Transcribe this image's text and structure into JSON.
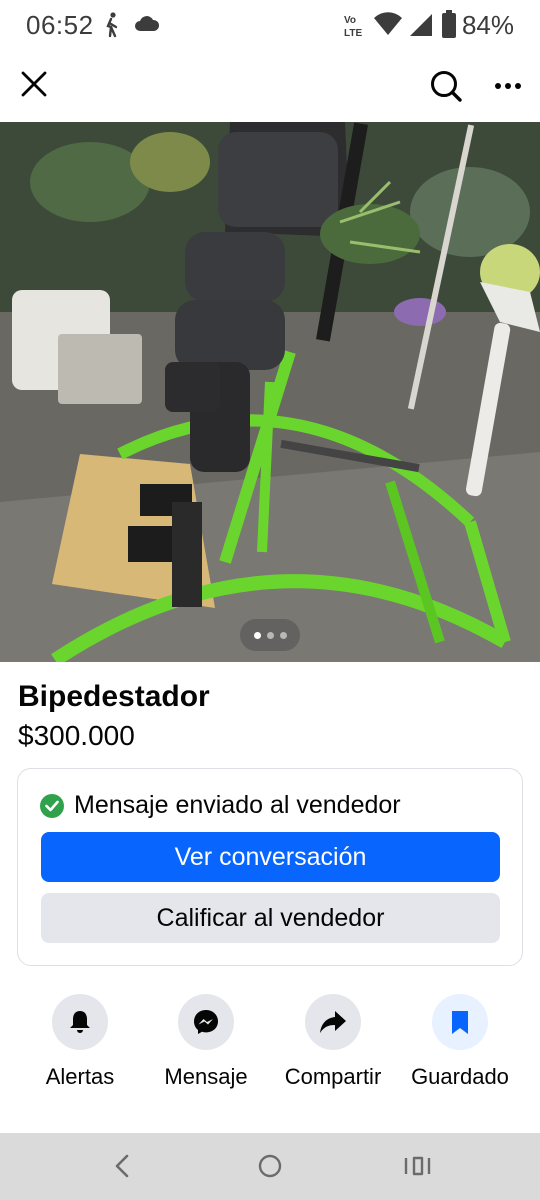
{
  "status_bar": {
    "time": "06:52",
    "network_label": "Vo LTE",
    "battery": "84%"
  },
  "top_bar": {
    "close_icon": "close-icon",
    "search_icon": "search-icon",
    "more_icon": "more-icon"
  },
  "photo": {
    "description_icon": "listing-photo",
    "page_count": 3,
    "active_page": 1
  },
  "listing": {
    "title": "Bipedestador",
    "price": "$300.000"
  },
  "message_card": {
    "status_text": "Mensaje enviado al vendedor",
    "primary_button": "Ver conversación",
    "secondary_button": "Calificar al vendedor"
  },
  "actions": [
    {
      "label": "Alertas",
      "icon": "bell-icon"
    },
    {
      "label": "Mensaje",
      "icon": "messenger-icon"
    },
    {
      "label": "Compartir",
      "icon": "share-icon"
    },
    {
      "label": "Guardado",
      "icon": "bookmark-icon"
    }
  ],
  "colors": {
    "primary_blue": "#0866ff",
    "success_green": "#31a24c",
    "secondary_gray": "#e4e6eb",
    "saved_bg": "#e7f1ff"
  }
}
